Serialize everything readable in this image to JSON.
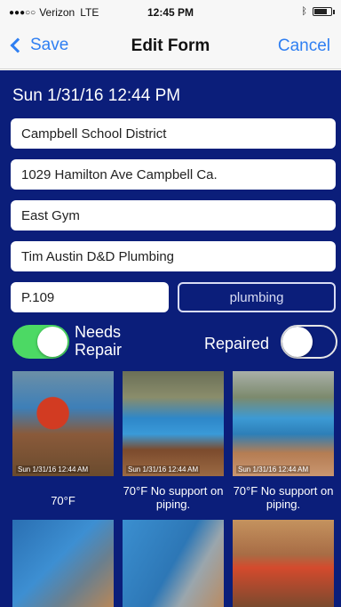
{
  "status": {
    "carrier": "Verizon",
    "network": "LTE",
    "time": "12:45 PM"
  },
  "nav": {
    "back_label": "Save",
    "title": "Edit Form",
    "cancel_label": "Cancel"
  },
  "form": {
    "datetime": "Sun 1/31/16 12:44 PM",
    "district": "Campbell School District",
    "address": "1029 Hamilton Ave Campbell Ca.",
    "location": "East Gym",
    "contact": "Tim Austin   D&D Plumbing",
    "code": "P.109",
    "category_button": "plumbing",
    "needs_repair": {
      "label_line1": "Needs",
      "label_line2": "Repair",
      "on": true
    },
    "repaired": {
      "label": "Repaired",
      "on": false
    }
  },
  "photos": [
    {
      "caption": "70°F",
      "stamp": "Sun 1/31/16 12:44 AM"
    },
    {
      "caption": "70°F No support on piping.",
      "stamp": "Sun 1/31/16 12:44 AM"
    },
    {
      "caption": "70°F No support on piping.",
      "stamp": "Sun 1/31/16 12:44 AM"
    },
    {
      "caption": "",
      "stamp": ""
    },
    {
      "caption": "",
      "stamp": ""
    },
    {
      "caption": "",
      "stamp": ""
    }
  ],
  "colors": {
    "form_bg": "#0b1e7a",
    "accent": "#2f7ff2",
    "toggle_on": "#4cd964"
  }
}
